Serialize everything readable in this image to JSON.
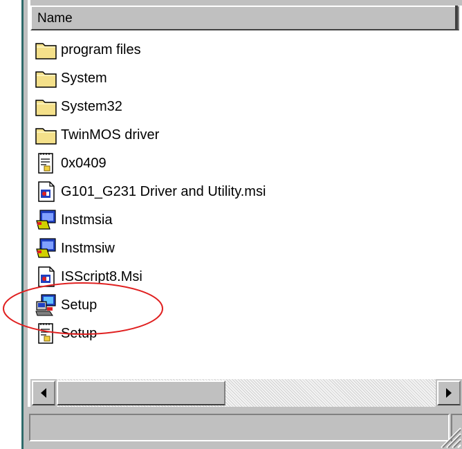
{
  "listview": {
    "column_header": "Name",
    "items": [
      {
        "label": "program files",
        "icon": "folder-icon"
      },
      {
        "label": "System",
        "icon": "folder-icon"
      },
      {
        "label": "System32",
        "icon": "folder-icon"
      },
      {
        "label": "TwinMOS driver",
        "icon": "folder-icon"
      },
      {
        "label": "0x0409",
        "icon": "ini-file-icon"
      },
      {
        "label": "G101_G231 Driver and Utility.msi",
        "icon": "msi-package-icon"
      },
      {
        "label": "Instmsia",
        "icon": "installer-exe-icon"
      },
      {
        "label": "Instmsiw",
        "icon": "installer-exe-icon"
      },
      {
        "label": "ISScript8.Msi",
        "icon": "msi-package-icon"
      },
      {
        "label": "Setup",
        "icon": "setup-exe-icon"
      },
      {
        "label": "Setup",
        "icon": "ini-file-icon"
      }
    ]
  },
  "annotation": {
    "highlighted_item": "Setup",
    "color": "#e02020"
  },
  "colors": {
    "frame_accent": "#2e6b6b",
    "chrome": "#c0c0c0",
    "folder": "#f4e08a"
  }
}
